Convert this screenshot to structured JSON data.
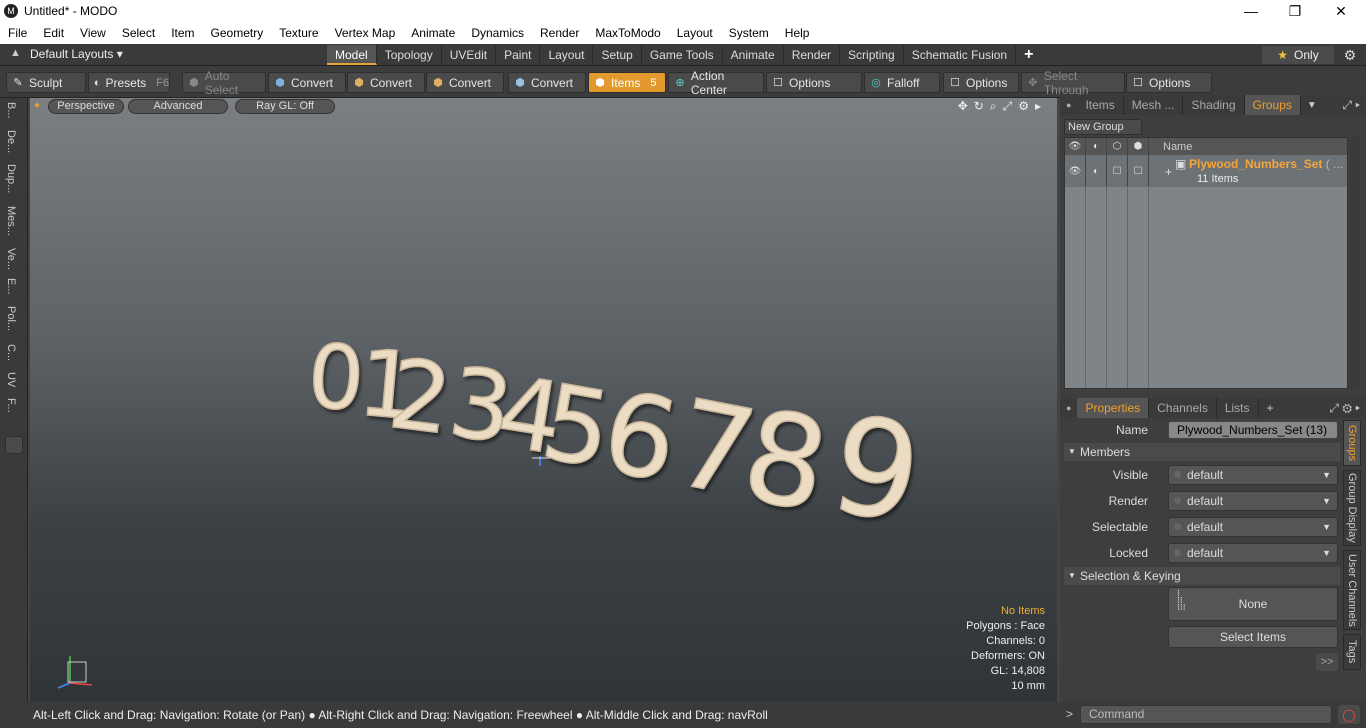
{
  "window": {
    "title": "Untitled* - MODO",
    "logo_letter": "M",
    "minimize": "—",
    "maximize": "❐",
    "close": "✕"
  },
  "menu": [
    "File",
    "Edit",
    "View",
    "Select",
    "Item",
    "Geometry",
    "Texture",
    "Vertex Map",
    "Animate",
    "Dynamics",
    "Render",
    "MaxToModo",
    "Layout",
    "System",
    "Help"
  ],
  "layouts": {
    "selector": "Default Layouts ▾",
    "tabs": [
      "Model",
      "Topology",
      "UVEdit",
      "Paint",
      "Layout",
      "Setup",
      "Game Tools",
      "Animate",
      "Render",
      "Scripting",
      "Schematic Fusion"
    ],
    "active": "Model",
    "add": "+",
    "only": "Only",
    "gear": "⚙"
  },
  "toolbar": {
    "sculpt": "Sculpt",
    "presets": "Presets",
    "presets_key": "F6",
    "auto_select": "Auto Select",
    "convert1": "Convert",
    "convert2": "Convert",
    "convert3": "Convert",
    "convert4": "Convert",
    "items": "Items",
    "items_key": "5",
    "action_center": "Action Center",
    "options1": "Options",
    "falloff": "Falloff",
    "options2": "Options",
    "select_through": "Select Through",
    "options3": "Options"
  },
  "left_tabs": [
    "B...",
    "De...",
    "Dup...",
    "Mes...",
    "Ve...",
    "E...",
    "Pol...",
    "C...",
    "UV",
    "F..."
  ],
  "viewport": {
    "perspective": "Perspective",
    "advanced": "Advanced",
    "raygl": "Ray GL: Off",
    "digits": [
      "0",
      "1",
      "2",
      "3",
      "4",
      "5",
      "6",
      "7",
      "8",
      "9"
    ],
    "hud": {
      "no_items": "No Items",
      "polygons": "Polygons : Face",
      "channels": "Channels: 0",
      "deformers": "Deformers: ON",
      "gl": "GL: 14,808",
      "scale": "10 mm"
    }
  },
  "status": "Alt-Left Click and Drag: Navigation: Rotate (or Pan) ● Alt-Right Click and Drag: Navigation: Freewheel ● Alt-Middle Click and Drag: navRoll",
  "command": {
    "placeholder": "Command"
  },
  "groups_panel": {
    "tabs": [
      "Items",
      "Mesh ...",
      "Shading",
      "Groups"
    ],
    "active": "Groups",
    "new_group": "New Group",
    "col_name": "Name",
    "group_name": "Plywood_Numbers_Set",
    "group_name_suffix": "( ...",
    "group_count": "11 Items"
  },
  "props_panel": {
    "tabs": [
      "Properties",
      "Channels",
      "Lists"
    ],
    "active": "Properties",
    "add": "+",
    "name_label": "Name",
    "name_value": "Plywood_Numbers_Set (13)",
    "members": "Members",
    "visible_label": "Visible",
    "visible_value": "default",
    "render_label": "Render",
    "render_value": "default",
    "selectable_label": "Selectable",
    "selectable_value": "default",
    "locked_label": "Locked",
    "locked_value": "default",
    "selection_keying": "Selection & Keying",
    "none": "None",
    "select_items": "Select Items",
    "more": ">>"
  },
  "side_tabs": [
    "Groups",
    "Group Display",
    "User Channels",
    "Tags"
  ]
}
